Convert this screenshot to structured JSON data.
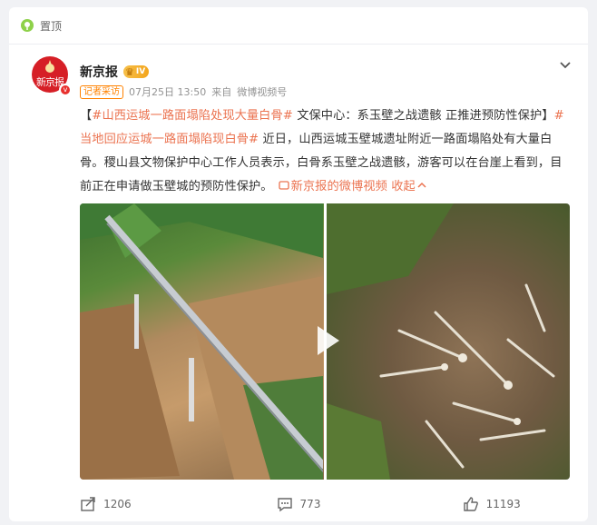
{
  "pin": {
    "label": "置顶",
    "icon": "pin-icon"
  },
  "post": {
    "author": "新京报",
    "vip_badge": "IV",
    "avatar_text": "新京报",
    "reporter_tag": "记者采访",
    "timestamp": "07月25日 13:50",
    "source_prefix": "来自",
    "source": "微博视频号",
    "hashtag1": "#山西运城一路面塌陷处现大量白骨#",
    "text1": " 文保中心：系玉壁之战遗骸 正推进预防性保护",
    "hashtag2": "#当地回应运城一路面塌陷现白骨#",
    "text2": " 近日，山西运城玉壁城遗址附近一路面塌陷处有大量白骨。稷山县文物保护中心工作人员表示，白骨系玉壁之战遗骸，游客可以在台崖上看到，目前正在申请做玉壁城的预防性保护。",
    "video_link": "新京报的微博视频",
    "collapse": "收起"
  },
  "footer": {
    "repost_count": "1206",
    "comment_count": "773",
    "like_count": "11193"
  },
  "colors": {
    "accent": "#eb7350",
    "brand": "#d61f26",
    "tag": "#ff8200"
  }
}
